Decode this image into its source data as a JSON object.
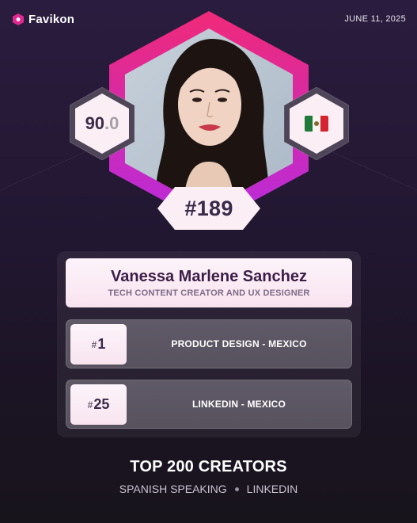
{
  "brand": {
    "name": "Favikon",
    "accent": "#e0288f"
  },
  "date": "JUNE 11, 2025",
  "profile": {
    "score_int": "90",
    "score_dot": ".",
    "score_dec": "0",
    "country_flag": "mexico-flag-icon",
    "rank_hash": "#",
    "rank": "189",
    "name": "Vanessa Marlene Sanchez",
    "title": "TECH CONTENT CREATOR AND UX DESIGNER"
  },
  "rankings": [
    {
      "hash": "#",
      "number": "1",
      "label": "PRODUCT DESIGN - MEXICO"
    },
    {
      "hash": "#",
      "number": "25",
      "label": "LINKEDIN - MEXICO"
    }
  ],
  "footer": {
    "title": "TOP 200 CREATORS",
    "sub_left": "SPANISH SPEAKING",
    "sub_right": "LINKEDIN"
  },
  "colors": {
    "hex_gradient_top": "#f02a78",
    "hex_gradient_bottom": "#b62be0",
    "photo_bg": "#b9c6d3"
  }
}
